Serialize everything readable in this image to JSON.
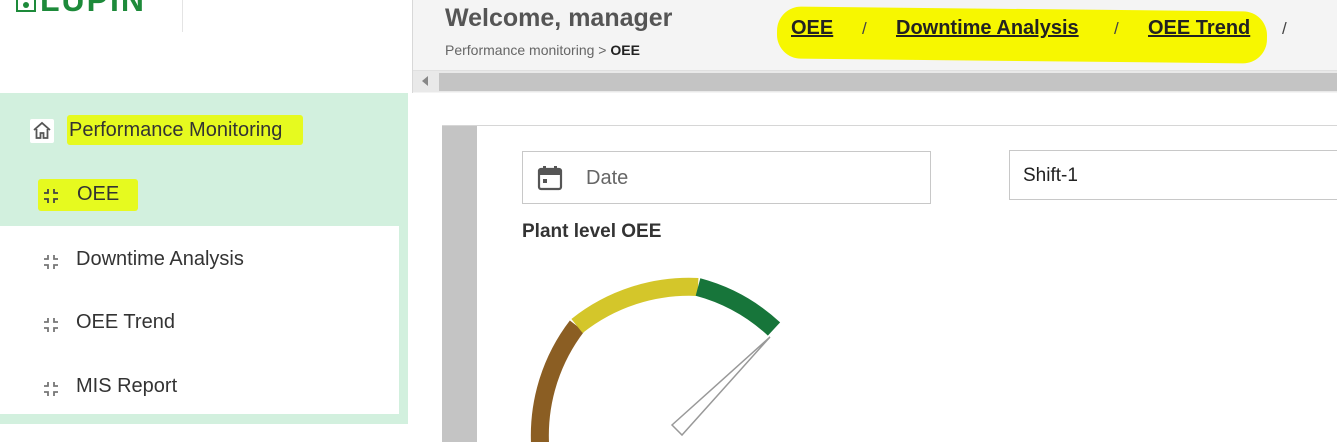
{
  "logo": {
    "text": "LUPIN"
  },
  "header": {
    "welcome": "Welcome, manager",
    "breadcrumb_parent": "Performance monitoring",
    "breadcrumb_sep": ">",
    "breadcrumb_current": "OEE"
  },
  "top_nav": {
    "links": [
      "OEE",
      "Downtime Analysis",
      "OEE Trend"
    ],
    "separator": "/"
  },
  "sidebar": {
    "section": {
      "label": "Performance Monitoring",
      "icon": "home-icon"
    },
    "items": [
      {
        "label": "OEE",
        "icon": "shrink-arrows-icon",
        "active": true
      },
      {
        "label": "Downtime Analysis",
        "icon": "shrink-arrows-icon"
      },
      {
        "label": "OEE Trend",
        "icon": "shrink-arrows-icon"
      },
      {
        "label": "MIS Report",
        "icon": "shrink-arrows-icon"
      }
    ]
  },
  "filters": {
    "date_placeholder": "Date",
    "shift_value": "Shift-1"
  },
  "panel": {
    "title": "Plant level OEE"
  },
  "colors": {
    "sidebar_bg": "#d2f0de",
    "highlight": "#f7f700",
    "gauge_low": "#8b5e23",
    "gauge_mid": "#d4c62a",
    "gauge_high": "#17753a",
    "brand": "#1d8a3a"
  }
}
